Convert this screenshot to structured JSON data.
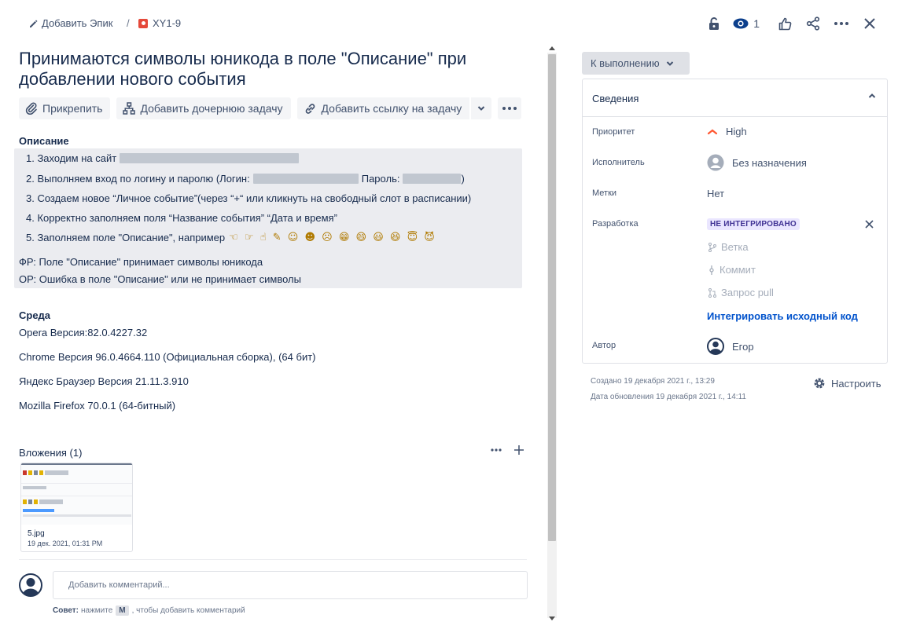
{
  "breadcrumb": {
    "epic_label": "Добавить Эпик",
    "separator": "/",
    "issue_key": "XY1-9"
  },
  "top_actions": {
    "watch_count": "1",
    "icons": [
      "lock-icon",
      "eye-icon",
      "thumbs-up-icon",
      "share-icon",
      "more-icon",
      "close-icon"
    ]
  },
  "issue": {
    "title": "Принимаются символы юникода в поле \"Описание\" при добавлении нового события"
  },
  "toolbar": {
    "attach": "Прикрепить",
    "add_child": "Добавить дочернюю задачу",
    "add_link": "Добавить ссылку на задачу"
  },
  "description": {
    "label": "Описание",
    "step1": "1. Заходим на сайт",
    "step2_a": "2. Выполняем вход по логину и паролю (Логин:",
    "step2_b": "Пароль:",
    "step2_c": ")",
    "step3": "3. Создаем новое “Личное событие”(через “+“ или кликнуть на свободный слот в расписании)",
    "step4": "4. Корректно заполняем поля “Название события” “Дата и время”",
    "step5": "5. Заполняем поле \"Описание\", например",
    "step5_emoji": "☜ ☞ ☝ ✎ ☺ ☻ ☹ 😁 😄 😃 😆 😇 😈",
    "fr": "ФР: Поле \"Описание\" принимает символы юникода",
    "or": "ОР: Ошибка в поле \"Описание\" или не принимает символы"
  },
  "environment": {
    "label": "Среда",
    "lines": [
      "Opera Версия:82.0.4227.32",
      "Chrome Версия 96.0.4664.110 (Официальная сборка), (64 бит)",
      "Яндекс Браузер Версия 21.11.3.910",
      "Mozilla Firefox 70.0.1 (64-битный)"
    ]
  },
  "attachments": {
    "header": "Вложения (1)",
    "file_name": "5.jpg",
    "file_date": "19 дек. 2021, 01:31 PM"
  },
  "comment": {
    "placeholder": "Добавить комментарий...",
    "tip_bold": "Совет:",
    "tip_before": "нажмите",
    "tip_key": "M",
    "tip_after": ", чтобы добавить комментарий"
  },
  "status": {
    "label": "К выполнению"
  },
  "details": {
    "header": "Сведения",
    "priority_label": "Приоритет",
    "priority_value": "High",
    "assignee_label": "Исполнитель",
    "assignee_value": "Без назначения",
    "labels_label": "Метки",
    "labels_value": "Нет",
    "dev_label": "Разработка",
    "dev_status": "НЕ ИНТЕГРИРОВАНО",
    "branch": "Ветка",
    "commit": "Коммит",
    "pull": "Запрос pull",
    "integrate": "Интегрировать исходный код",
    "author_label": "Автор",
    "author_value": "Егор"
  },
  "meta": {
    "created": "Создано 19 декабря 2021 г., 13:29",
    "updated": "Дата обновления 19 декабря 2021 г., 14:11",
    "configure": "Настроить"
  },
  "colors": {
    "accent": "#0052cc",
    "bug": "#e5493a",
    "priority_high": "#ff5630",
    "lozenge_bg": "#eae6ff",
    "lozenge_text": "#403294"
  }
}
